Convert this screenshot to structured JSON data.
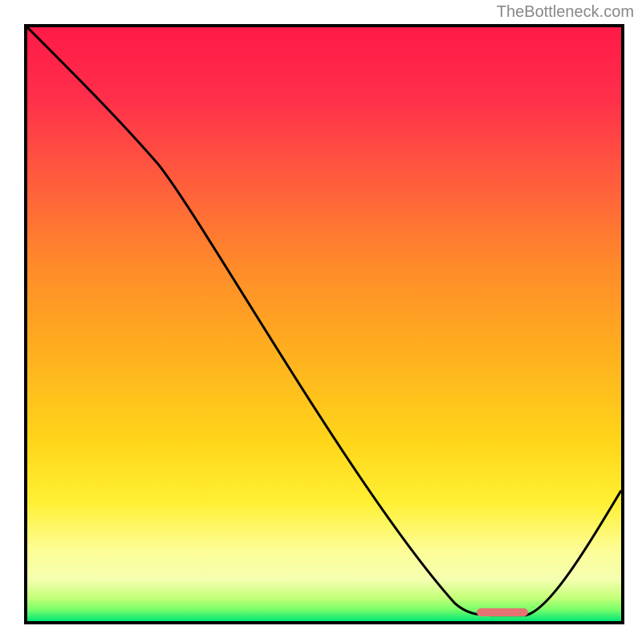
{
  "watermark": "TheBottleneck.com",
  "chart_data": {
    "type": "line",
    "title": "",
    "xlabel": "",
    "ylabel": "",
    "xlim": [
      0,
      100
    ],
    "ylim": [
      0,
      100
    ],
    "series": [
      {
        "name": "bottleneck-curve",
        "x": [
          0,
          22,
          72,
          76,
          84,
          100
        ],
        "y": [
          100,
          77,
          3,
          1,
          1,
          22
        ]
      }
    ],
    "optimal_range": {
      "start": 76,
      "end": 84,
      "y": 1
    },
    "background": {
      "type": "vertical-gradient",
      "stops": [
        {
          "pos": 0,
          "color": "#ff1744"
        },
        {
          "pos": 20,
          "color": "#ff5252"
        },
        {
          "pos": 40,
          "color": "#ff9800"
        },
        {
          "pos": 60,
          "color": "#ffc107"
        },
        {
          "pos": 75,
          "color": "#ffeb3b"
        },
        {
          "pos": 88,
          "color": "#fff59d"
        },
        {
          "pos": 96,
          "color": "#c6ff00"
        },
        {
          "pos": 100,
          "color": "#00e676"
        }
      ]
    }
  }
}
